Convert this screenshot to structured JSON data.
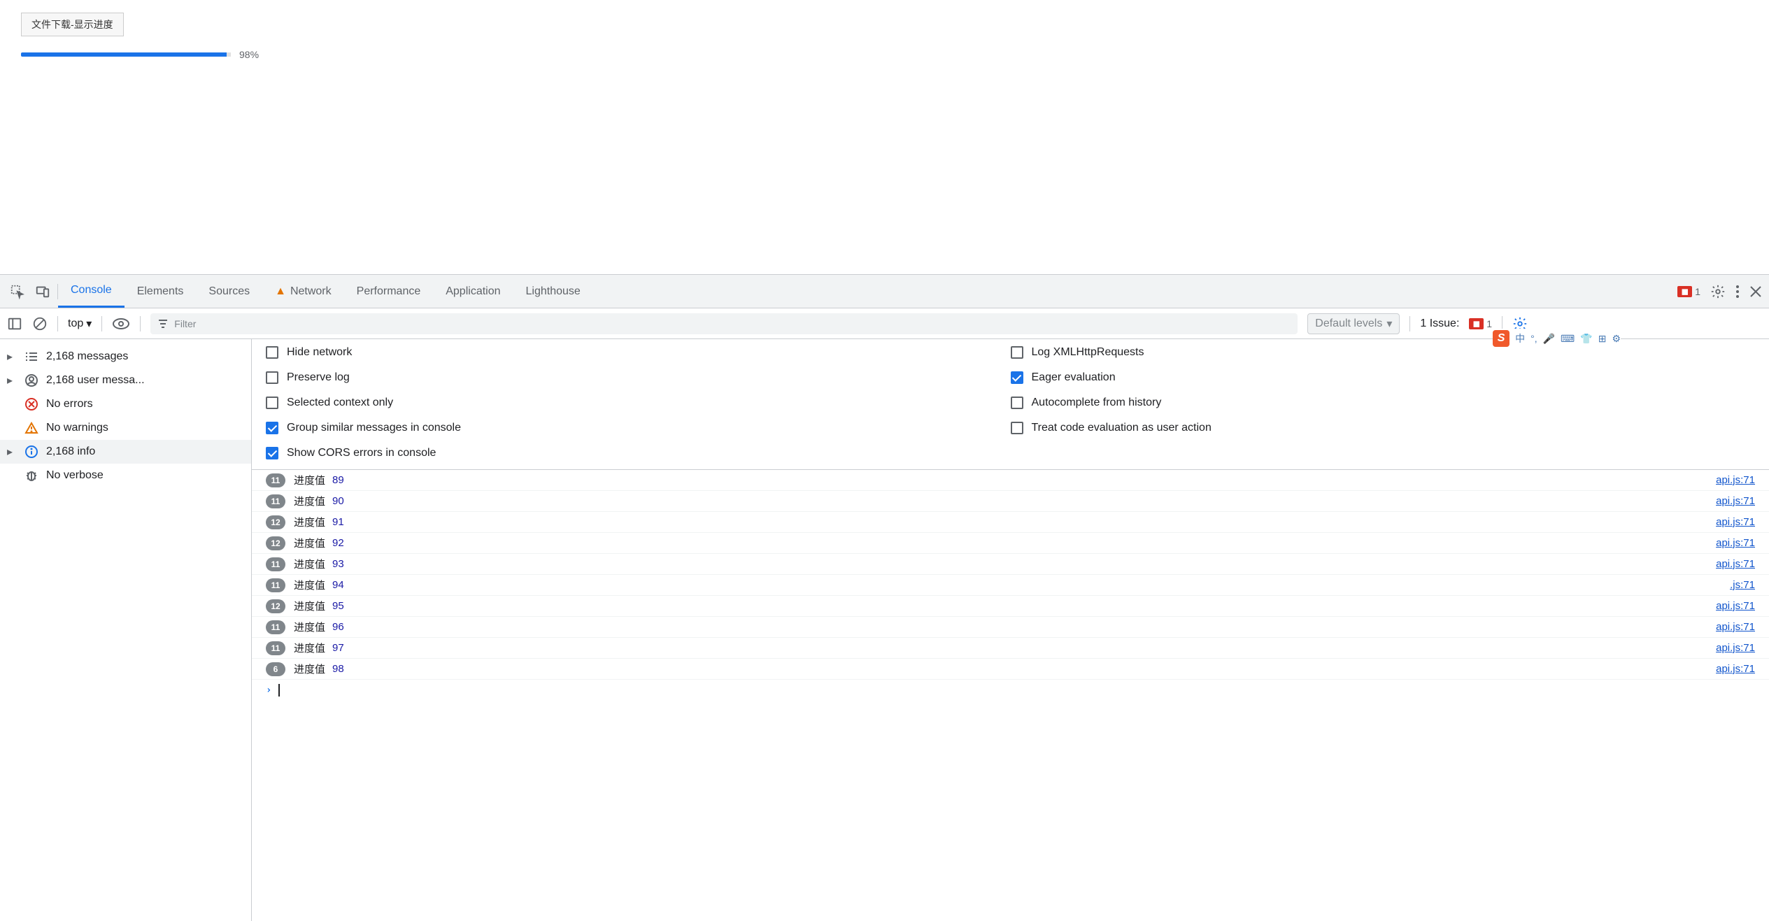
{
  "page": {
    "button_label": "文件下载-显示进度",
    "progress_percent": "98%"
  },
  "tabs": {
    "console": "Console",
    "elements": "Elements",
    "sources": "Sources",
    "network": "Network",
    "performance": "Performance",
    "application": "Application",
    "lighthouse": "Lighthouse"
  },
  "toolbar": {
    "error_count": "1",
    "context": "top",
    "filter_placeholder": "Filter",
    "levels": "Default levels",
    "issue_label": "1 Issue:",
    "issue_count": "1"
  },
  "sidebar": {
    "messages": "2,168 messages",
    "user": "2,168 user messa...",
    "errors": "No errors",
    "warnings": "No warnings",
    "info": "2,168 info",
    "verbose": "No verbose"
  },
  "options": {
    "hide_network": "Hide network",
    "preserve_log": "Preserve log",
    "selected_context": "Selected context only",
    "group_similar": "Group similar messages in console",
    "show_cors": "Show CORS errors in console",
    "log_xhr": "Log XMLHttpRequests",
    "eager_eval": "Eager evaluation",
    "autocomplete": "Autocomplete from history",
    "treat_code": "Treat code evaluation as user action"
  },
  "logs": [
    {
      "count": "11",
      "label": "进度值",
      "value": "89",
      "src": "api.js:71"
    },
    {
      "count": "11",
      "label": "进度值",
      "value": "90",
      "src": "api.js:71"
    },
    {
      "count": "12",
      "label": "进度值",
      "value": "91",
      "src": "api.js:71"
    },
    {
      "count": "12",
      "label": "进度值",
      "value": "92",
      "src": "api.js:71"
    },
    {
      "count": "11",
      "label": "进度值",
      "value": "93",
      "src": "api.js:71"
    },
    {
      "count": "11",
      "label": "进度值",
      "value": "94",
      "src": ".js:71"
    },
    {
      "count": "12",
      "label": "进度值",
      "value": "95",
      "src": "api.js:71"
    },
    {
      "count": "11",
      "label": "进度值",
      "value": "96",
      "src": "api.js:71"
    },
    {
      "count": "11",
      "label": "进度值",
      "value": "97",
      "src": "api.js:71"
    },
    {
      "count": "6",
      "label": "进度值",
      "value": "98",
      "src": "api.js:71"
    }
  ],
  "ime": {
    "lang": "中"
  }
}
